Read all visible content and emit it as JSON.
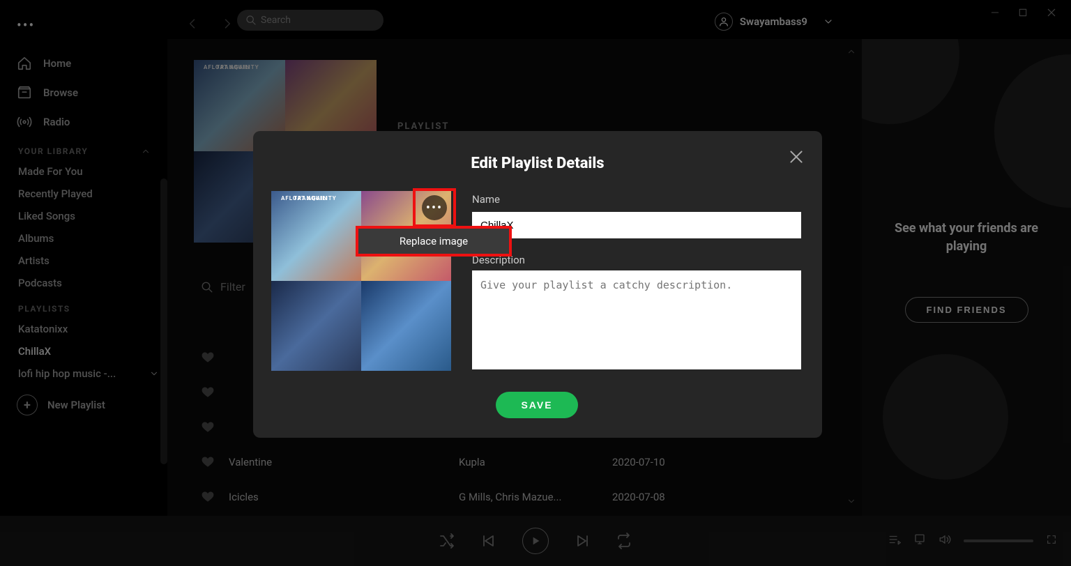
{
  "topbar": {
    "search_placeholder": "Search",
    "username": "Swayambass9"
  },
  "sidebar": {
    "main_items": [
      {
        "label": "Home"
      },
      {
        "label": "Browse"
      },
      {
        "label": "Radio"
      }
    ],
    "library_header": "YOUR LIBRARY",
    "library_items": [
      "Made For You",
      "Recently Played",
      "Liked Songs",
      "Albums",
      "Artists",
      "Podcasts"
    ],
    "playlists_header": "PLAYLISTS",
    "playlist_items": [
      "Katatonixx",
      "ChillaX",
      "lofi hip hop music -..."
    ],
    "active_playlist_index": 1,
    "new_playlist_label": "New Playlist"
  },
  "main": {
    "playlist_label": "PLAYLIST",
    "cover_quadrant_labels": {
      "tl": "TRANQUILITY",
      "tr": "AFLOAT AGAIN"
    },
    "filter_label": "Filter",
    "tracks": [
      {
        "title": "Valentine",
        "artist": "Kupla",
        "date": "2020-07-10"
      },
      {
        "title": "Icicles",
        "artist": "G Mills, Chris Mazue...",
        "date": "2020-07-08"
      }
    ]
  },
  "friends": {
    "heading": "See what your friends are playing",
    "button": "FIND FRIENDS"
  },
  "modal": {
    "title": "Edit Playlist Details",
    "name_label": "Name",
    "name_value": "ChillaX",
    "desc_label": "Description",
    "desc_placeholder": "Give your playlist a catchy description.",
    "save_label": "SAVE",
    "replace_image_label": "Replace image"
  }
}
